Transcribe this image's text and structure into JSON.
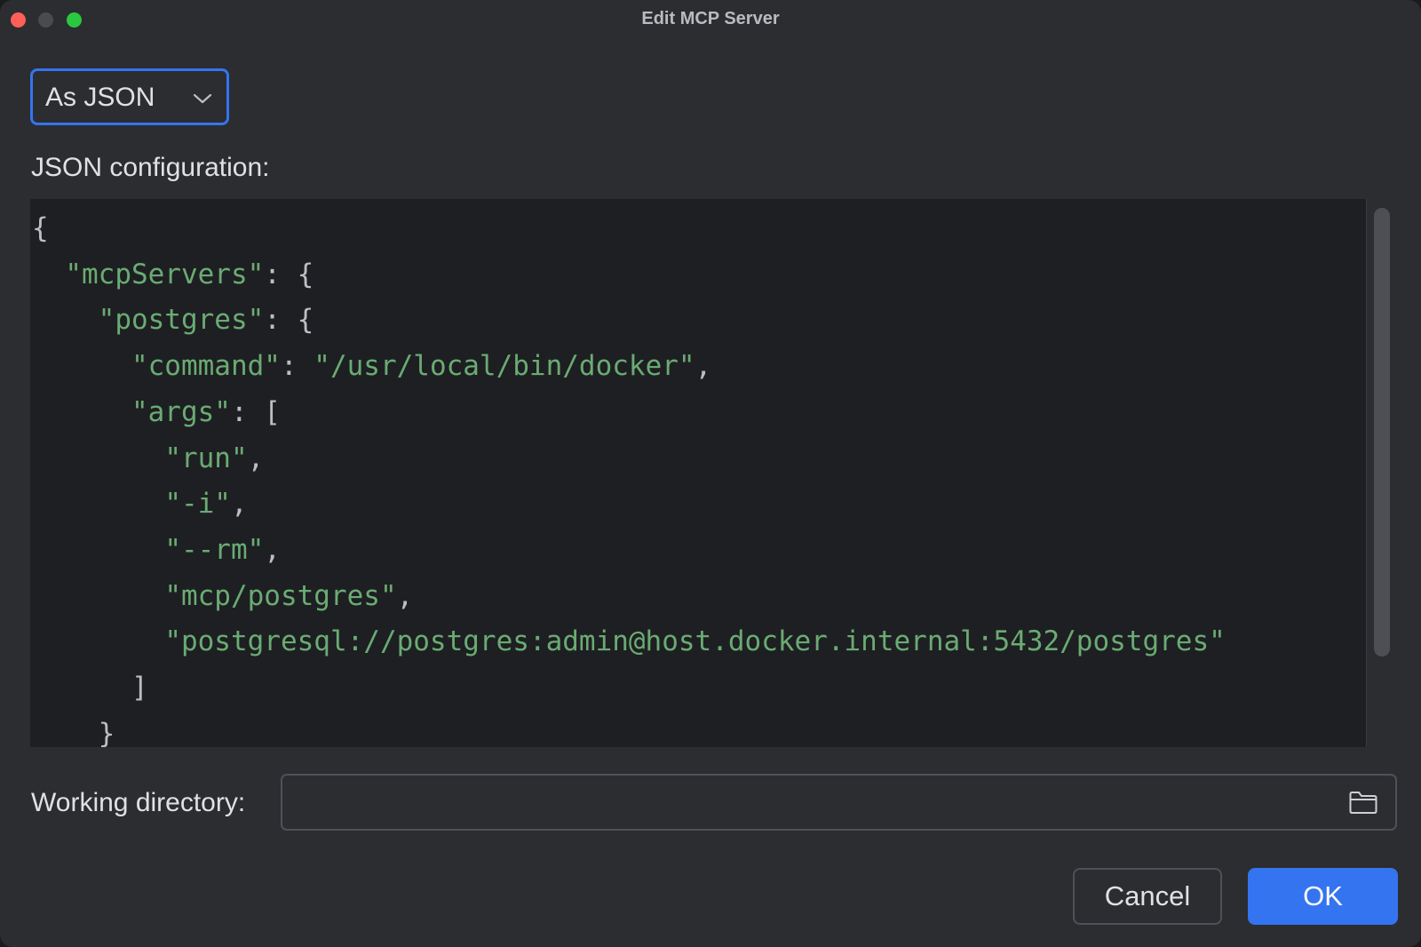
{
  "window": {
    "title": "Edit MCP Server"
  },
  "mode_select": {
    "value": "As JSON",
    "icon": "chevron-down-icon"
  },
  "json_label": "JSON configuration:",
  "editor": {
    "lines": [
      [
        {
          "t": "{",
          "c": "pun"
        }
      ],
      [
        {
          "t": "  ",
          "c": "pun"
        },
        {
          "t": "\"mcpServers\"",
          "c": "str"
        },
        {
          "t": ": {",
          "c": "pun"
        }
      ],
      [
        {
          "t": "    ",
          "c": "pun"
        },
        {
          "t": "\"postgres\"",
          "c": "str"
        },
        {
          "t": ": {",
          "c": "pun"
        }
      ],
      [
        {
          "t": "      ",
          "c": "pun"
        },
        {
          "t": "\"command\"",
          "c": "str"
        },
        {
          "t": ": ",
          "c": "pun"
        },
        {
          "t": "\"/usr/local/bin/docker\"",
          "c": "str"
        },
        {
          "t": ",",
          "c": "pun"
        }
      ],
      [
        {
          "t": "      ",
          "c": "pun"
        },
        {
          "t": "\"args\"",
          "c": "str"
        },
        {
          "t": ": [",
          "c": "pun"
        }
      ],
      [
        {
          "t": "        ",
          "c": "pun"
        },
        {
          "t": "\"run\"",
          "c": "str"
        },
        {
          "t": ",",
          "c": "pun"
        }
      ],
      [
        {
          "t": "        ",
          "c": "pun"
        },
        {
          "t": "\"-i\"",
          "c": "str"
        },
        {
          "t": ",",
          "c": "pun"
        }
      ],
      [
        {
          "t": "        ",
          "c": "pun"
        },
        {
          "t": "\"--rm\"",
          "c": "str"
        },
        {
          "t": ",",
          "c": "pun"
        }
      ],
      [
        {
          "t": "        ",
          "c": "pun"
        },
        {
          "t": "\"mcp/postgres\"",
          "c": "str"
        },
        {
          "t": ",",
          "c": "pun"
        }
      ],
      [
        {
          "t": "        ",
          "c": "pun"
        },
        {
          "t": "\"postgresql://postgres:admin@host.docker.internal:5432/postgres\"",
          "c": "str"
        }
      ],
      [
        {
          "t": "      ]",
          "c": "pun"
        }
      ],
      [
        {
          "t": "    }",
          "c": "pun"
        }
      ]
    ]
  },
  "working_directory": {
    "label": "Working directory:",
    "value": "",
    "icon": "folder-icon"
  },
  "buttons": {
    "cancel": "Cancel",
    "ok": "OK"
  },
  "colors": {
    "accent": "#3574f0",
    "string": "#6aab73",
    "punctuation": "#bcbec4"
  }
}
